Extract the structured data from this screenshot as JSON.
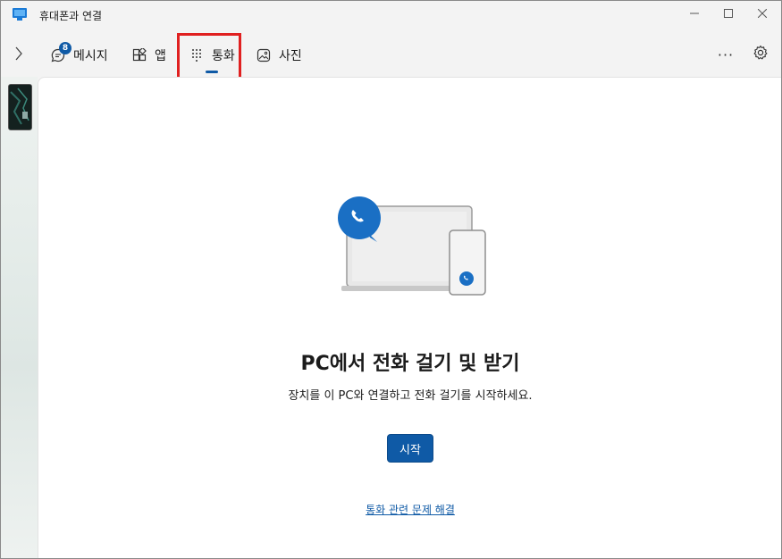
{
  "window": {
    "title": "휴대폰과 연결",
    "controls": {
      "minimize_icon": "minimize-icon",
      "maximize_icon": "maximize-icon",
      "close_icon": "close-icon"
    }
  },
  "toolbar": {
    "expand_icon": "chevron-right-icon",
    "tabs": [
      {
        "label": "메시지",
        "icon": "chat-icon",
        "badge": "8"
      },
      {
        "label": "앱",
        "icon": "apps-icon"
      },
      {
        "label": "통화",
        "icon": "dialpad-icon",
        "selected": true
      },
      {
        "label": "사진",
        "icon": "photo-icon"
      }
    ],
    "more_label": "···",
    "settings_icon": "gear-icon"
  },
  "main": {
    "headline": "PC에서 전화 걸기 및 받기",
    "subtext": "장치를 이 PC와 연결하고 전화 걸기를 시작하세요.",
    "start_button": "시작",
    "help_link": "통화 관련 문제 해결"
  },
  "colors": {
    "accent": "#0f5aa6",
    "highlight": "#e02020"
  }
}
